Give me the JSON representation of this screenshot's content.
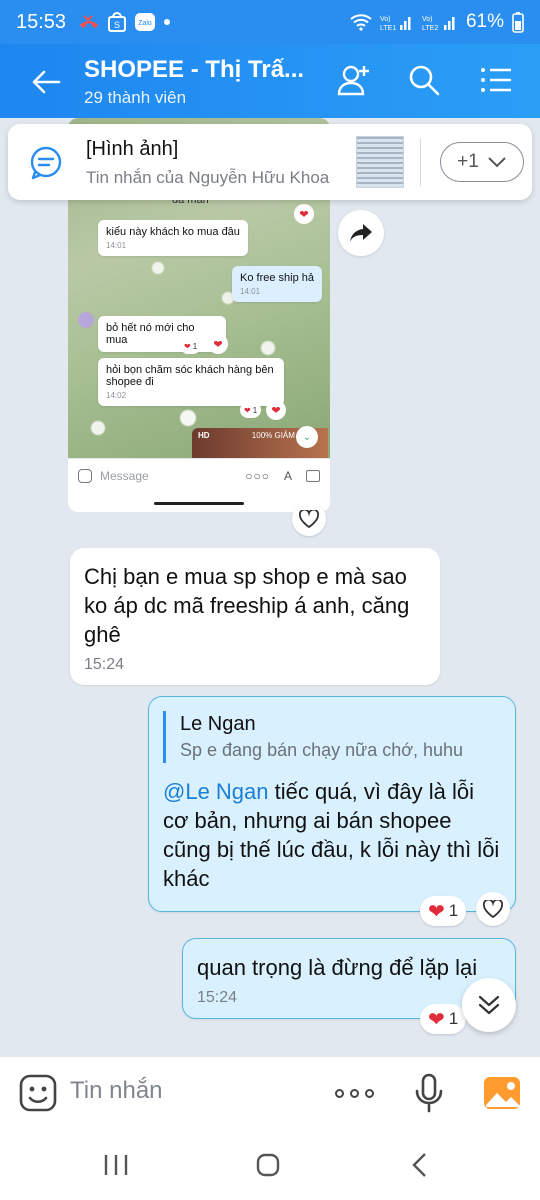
{
  "status_bar": {
    "time": "15:53",
    "carrier1": "VoLTE1",
    "carrier2": "VoLTE2",
    "battery": "61%"
  },
  "header": {
    "title": "SHOPEE - Thị Trấ...",
    "subtitle": "29 thành viên"
  },
  "pinned": {
    "title": "[Hình ảnh]",
    "subtitle": "Tin nhắn của Nguyễn Hữu Khoa",
    "count": "+1"
  },
  "screenshot": {
    "top_text": "đã mắn",
    "messages": [
      {
        "text": "kiểu này khách ko mua đâu",
        "time": "14:01"
      },
      {
        "text": "Ko free ship hả",
        "time": "14:01"
      },
      {
        "text": "bỏ hết nó mới cho mua",
        "time": ""
      },
      {
        "text": "hỏi bọn chăm sóc khách hàng bên shopee đi",
        "time": "14:02"
      }
    ],
    "react_count_1": "1",
    "react_count_2": "1",
    "hd_label": "HD",
    "hd_text": "100% GIẢM",
    "input_placeholder": "Message"
  },
  "messages": [
    {
      "text": "Chị bạn e mua sp shop e mà sao ko áp dc mã freeship á anh, căng ghê",
      "time": "15:24"
    },
    {
      "quote_name": "Le Ngan",
      "quote_text": "Sp e đang bán chạy nữa chớ, huhu",
      "mention": "@Le Ngan",
      "text": " tiếc quá, vì đây là lỗi cơ bản, nhưng ai bán shopee cũng bị thế lúc đầu, k lỗi này thì lỗi khác",
      "reaction_count": "1"
    },
    {
      "text": "quan trọng là đừng để lặp lại",
      "time": "15:24",
      "reaction_count": "1"
    }
  ],
  "input": {
    "placeholder": "Tin nhắn"
  },
  "colors": {
    "header": "#2a8ef0",
    "mine_bubble": "#d9f1ff",
    "mine_border": "#57b5de",
    "heart": "#e02b3b"
  }
}
